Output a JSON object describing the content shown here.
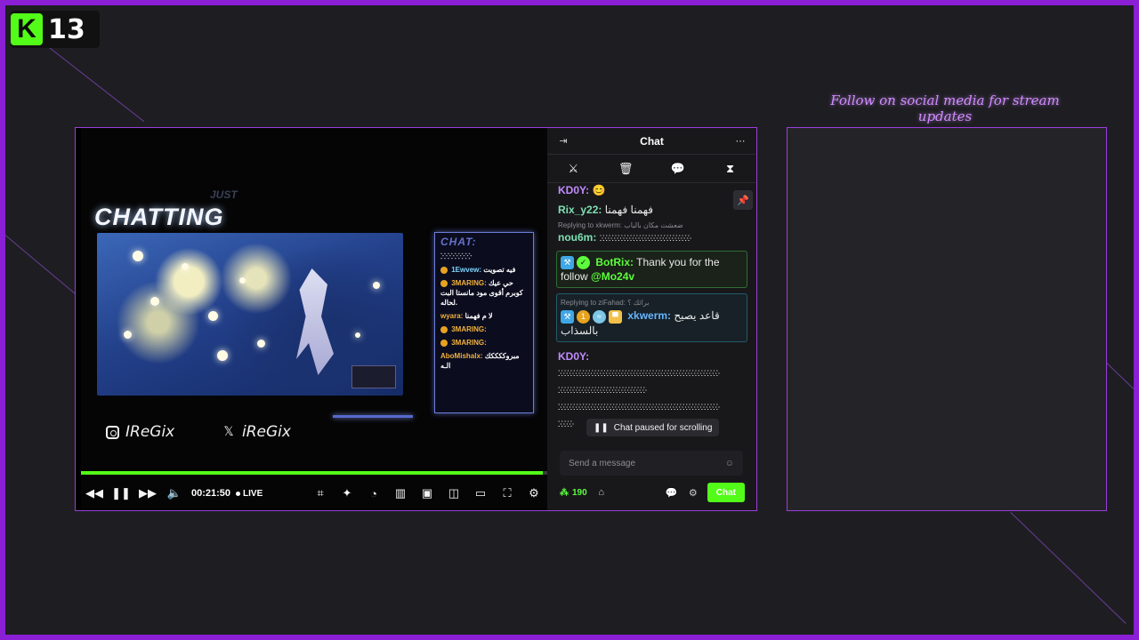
{
  "brand": {
    "letter": "K",
    "number": "13",
    "accent": "#53fc18",
    "frame_color": "#8a1fd6"
  },
  "banner": {
    "text": "Follow on social media for stream updates"
  },
  "stream": {
    "just_label": "JUST",
    "chatting_label": "CHATTING",
    "overlay_chat": {
      "title": "CHAT:",
      "messages": [
        {
          "user": "",
          "text": "ⴾⴾⴾⴾⴾⴾⴾⴾⴾ"
        },
        {
          "user": "1Ewvew:",
          "text": "فيه تصويت"
        },
        {
          "user": "3MARING:",
          "text": "حي عيك كوبرم أقوى مود مانستا البت لحاله."
        },
        {
          "user": "wyara:",
          "text": "لا م فهمنا"
        },
        {
          "user": "3MARING:",
          "text": ""
        },
        {
          "user": "3MARING:",
          "text": ""
        },
        {
          "user": "AboMishalx:",
          "text": "مبروككككك الـه"
        }
      ]
    },
    "socials": [
      {
        "icon": "instagram-icon",
        "handle": "IReGix"
      },
      {
        "icon": "x-icon",
        "handle": "iReGix"
      }
    ],
    "progress": 0.99,
    "time": "00:21:50",
    "live_label": "LIVE"
  },
  "chat": {
    "title": "Chat",
    "messages": [
      {
        "user": "KD0Y:",
        "color": "purple",
        "text": ""
      },
      {
        "user": "Rix_y22:",
        "color": "teal",
        "text": "فهمنا فهمنا"
      },
      {
        "reply": "Replying to xkwerm: ضعشت مكان بالباب",
        "user": "nou6m:",
        "color": "teal",
        "text": "ⴾⴾⴾⴾⴾⴾⴾⴾⴾⴾⴾⴾⴾⴾⴾⴾⴾⴾⴾⴾⴾⴾⴾⴾⴾⴾⴾⴾⴾⴾ"
      },
      {
        "user": "BotRix:",
        "color": "green",
        "text": "Thank you for the follow",
        "mention": "@Mo24v"
      },
      {
        "reply": "Replying to ziFahad: برائك ؟",
        "user": "xkwerm:",
        "color": "blue",
        "text": "قاعد يصيح بالسذاب"
      },
      {
        "user": "KD0Y:",
        "color": "purple",
        "text": ""
      }
    ],
    "spam_lines": [
      "ⴾⴾⴾⴾⴾⴾⴾⴾⴾⴾⴾⴾⴾⴾⴾⴾⴾⴾⴾⴾⴾⴾⴾⴾⴾⴾⴾⴾⴾⴾⴾⴾⴾⴾⴾⴾⴾⴾⴾⴾⴾⴾⴾⴾⴾⴾⴾⴾⴾⴾⴾⴾⴾ",
      "ⴾⴾⴾⴾⴾⴾⴾⴾⴾⴾⴾⴾⴾⴾⴾⴾⴾⴾⴾⴾⴾⴾⴾⴾⴾⴾⴾⴾⴾ",
      "ⴾⴾⴾⴾⴾⴾⴾⴾⴾⴾⴾⴾⴾⴾⴾⴾⴾⴾⴾⴾⴾⴾⴾⴾⴾⴾⴾⴾⴾⴾⴾⴾⴾⴾⴾⴾⴾⴾⴾⴾⴾⴾⴾⴾⴾⴾⴾⴾⴾⴾⴾⴾⴾ",
      "ⴾⴾⴾⴾⴾ"
    ],
    "paused_label": "Chat paused for scrolling",
    "input_placeholder": "Send a message",
    "points": "190",
    "send_label": "Chat"
  }
}
